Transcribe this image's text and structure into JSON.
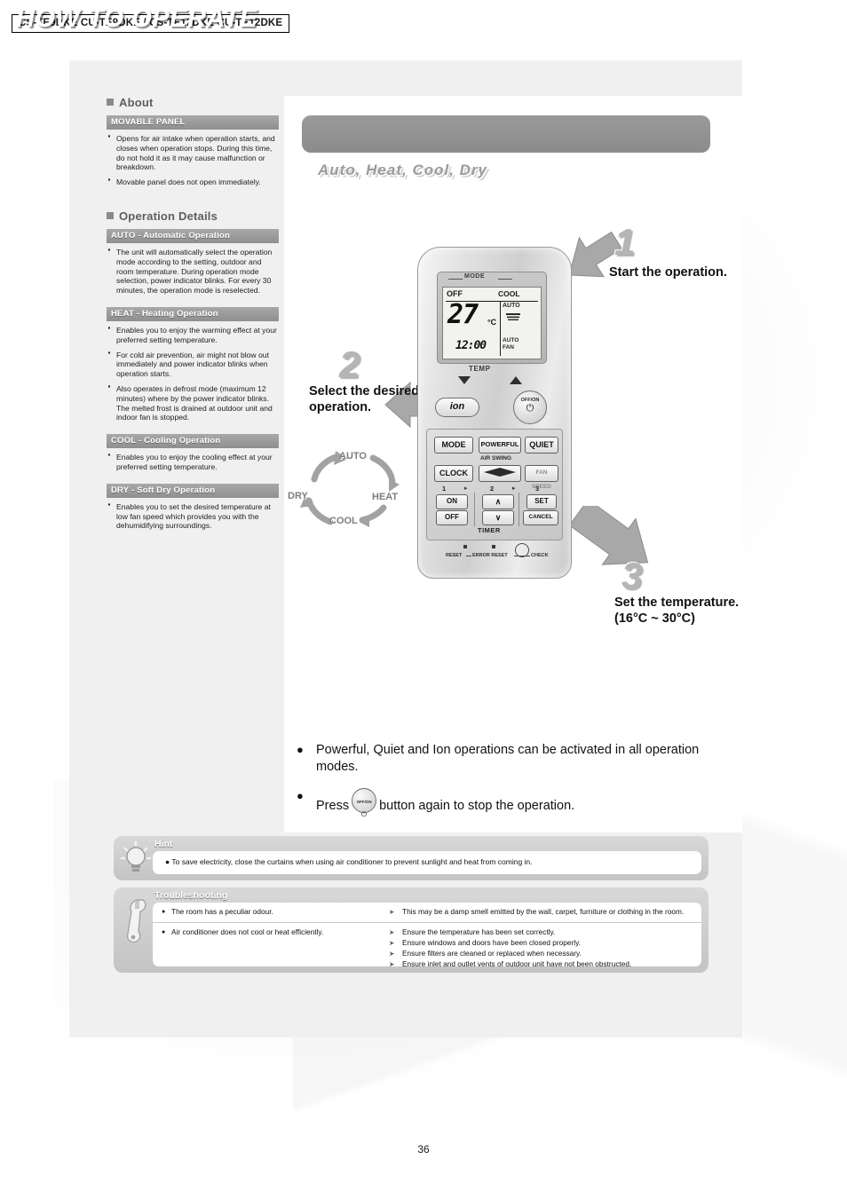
{
  "model_header": "CS-TE9DKE CU-TE9DKE / CS-TE12DKE CU-TE12DKE",
  "page_number": "36",
  "sidebar": {
    "about": {
      "heading": "About",
      "band": "MOVABLE PANEL",
      "bullets": [
        "Opens for air intake when operation starts, and closes when operation stops. During this time, do not hold it as it may cause malfunction or breakdown.",
        "Movable panel does not open immediately."
      ]
    },
    "operation_details": {
      "heading": "Operation Details",
      "sections": [
        {
          "band": "AUTO - Automatic Operation",
          "bullets": [
            "The unit will automatically select the operation mode according to the setting, outdoor and room temperature. During operation mode selection, power indicator blinks. For every 30 minutes, the operation mode is reselected."
          ]
        },
        {
          "band": "HEAT - Heating Operation",
          "bullets": [
            "Enables you to enjoy the warming effect at your preferred setting temperature.",
            "For cold air prevention, air might not blow out immediately and power indicator blinks when operation starts.",
            "Also operates in defrost mode (maximum 12 minutes) where by the power indicator blinks. The melted frost is drained at outdoor unit and indoor fan is stopped."
          ]
        },
        {
          "band": "COOL - Cooling Operation",
          "bullets": [
            "Enables you to enjoy the cooling effect at your preferred setting temperature."
          ]
        },
        {
          "band": "DRY - Soft Dry Operation",
          "bullets": [
            "Enables you to set the desired temperature at low fan speed which provides you with the dehumidifying surroundings."
          ]
        }
      ]
    }
  },
  "main": {
    "title": "HOW TO OPERATE",
    "subtitle": "Auto, Heat, Cool, Dry",
    "steps": [
      {
        "number": "1",
        "text": "Start the operation."
      },
      {
        "number": "2",
        "text": "Select the desired operation."
      },
      {
        "number": "3",
        "text": "Set the temperature. (16°C ~ 30°C)"
      }
    ],
    "mode_cycle": [
      "AUTO",
      "HEAT",
      "COOL",
      "DRY"
    ],
    "notes": [
      "Powerful, Quiet and Ion operations can be activated in all operation modes.",
      "button again to stop the operation."
    ],
    "note2_prefix": "Press"
  },
  "remote": {
    "lcd": {
      "mode_label": "MODE",
      "off": "OFF",
      "mode_value": "COOL",
      "temperature": "27",
      "temperature_unit": "°C",
      "swing_auto": "AUTO",
      "fan_auto": "AUTO",
      "fan_label": "FAN",
      "clock": "12:00"
    },
    "temp_label": "TEMP",
    "timer_label": "TIMER",
    "air_swing_label": "AIR SWING",
    "buttons": {
      "ion": "ion",
      "off_on_top": "OFF/ON",
      "off_on_power": "⏻",
      "mode": "MODE",
      "powerful": "POWERFUL",
      "quiet": "QUIET",
      "clock": "CLOCK",
      "fan_speed": "FAN SPEED",
      "on": "ON",
      "off": "OFF",
      "up": "∧",
      "down": "∨",
      "set": "SET",
      "cancel": "CANCEL"
    },
    "timer_numbers": [
      "1",
      "2",
      "3"
    ],
    "bottom_labels": [
      "RESET",
      "ERROR RESET",
      "CHECK"
    ]
  },
  "hint": {
    "title": "Hint",
    "text": "To save electricity, close the curtains when using air conditioner to prevent sunlight and heat from coming in."
  },
  "troubleshooting": {
    "title": "Troubleshooting",
    "rows": [
      {
        "symptom": "The room has a peculiar odour.",
        "fixes": [
          "This may be a damp smell emitted by the wall, carpet, furniture or clothing in the room."
        ]
      },
      {
        "symptom": "Air conditioner does not cool or heat efficiently.",
        "fixes": [
          "Ensure the temperature has been set correctly.",
          "Ensure windows and doors have been closed properly.",
          "Ensure filters are cleaned or replaced when necessary.",
          "Ensure inlet and outlet vents of outdoor unit have not been obstructed."
        ]
      }
    ]
  }
}
